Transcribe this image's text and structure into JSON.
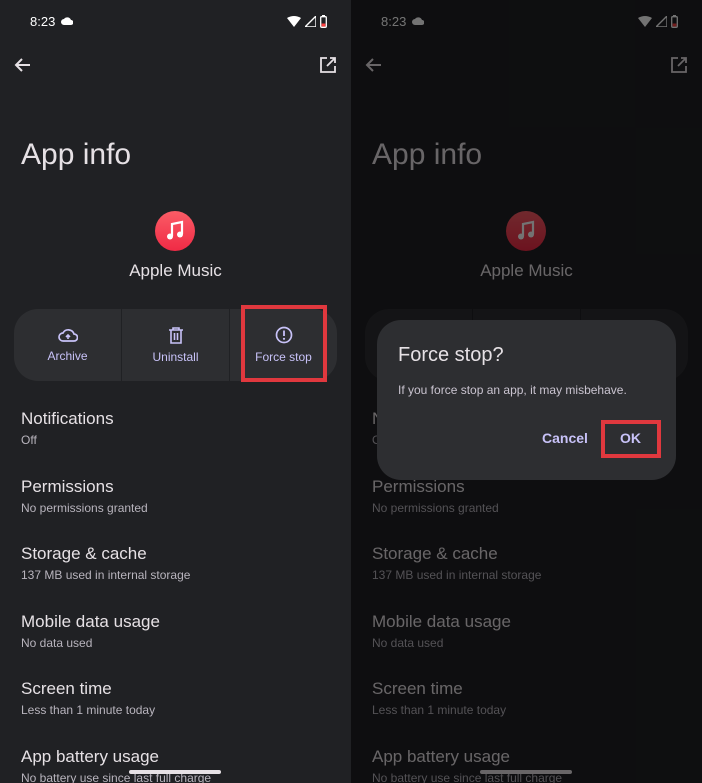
{
  "status_bar": {
    "time": "8:23"
  },
  "page": {
    "title": "App info",
    "app_name": "Apple Music"
  },
  "actions": [
    {
      "label": "Archive",
      "icon": "cloud-upload-icon"
    },
    {
      "label": "Uninstall",
      "icon": "trash-icon"
    },
    {
      "label": "Force stop",
      "icon": "alert-circle-icon"
    }
  ],
  "settings": [
    {
      "title": "Notifications",
      "subtitle": "Off"
    },
    {
      "title": "Permissions",
      "subtitle": "No permissions granted"
    },
    {
      "title": "Storage & cache",
      "subtitle": "137 MB used in internal storage"
    },
    {
      "title": "Mobile data usage",
      "subtitle": "No data used"
    },
    {
      "title": "Screen time",
      "subtitle": "Less than 1 minute today"
    },
    {
      "title": "App battery usage",
      "subtitle": "No battery use since last full charge"
    }
  ],
  "dialog": {
    "title": "Force stop?",
    "message": "If you force stop an app, it may misbehave.",
    "cancel_label": "Cancel",
    "ok_label": "OK"
  },
  "colors": {
    "background": "#202124",
    "card": "#2d2e31",
    "accent": "#c8c2f8",
    "highlight": "#e0383e",
    "app_icon": "#f02a45"
  }
}
